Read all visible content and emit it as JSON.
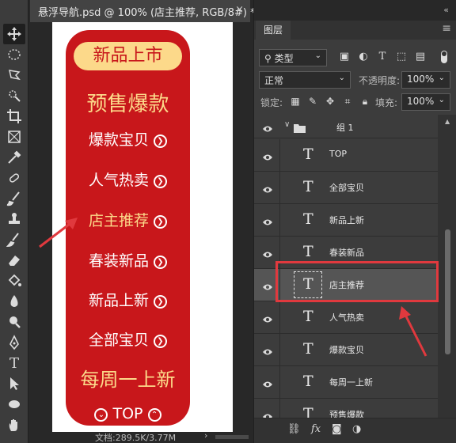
{
  "document": {
    "tab_title": "悬浮导航.psd @ 100% (店主推荐, RGB/8#) *",
    "close_glyph": "×"
  },
  "toolbar": {
    "tools": [
      "move-tool",
      "marquee-tool",
      "lasso-tool",
      "quick-select-tool",
      "crop-tool",
      "frame-tool",
      "eyedropper-tool",
      "healing-brush-tool",
      "brush-tool",
      "stamp-tool",
      "history-brush-tool",
      "eraser-tool",
      "paint-bucket-tool",
      "blur-tool",
      "dodge-tool",
      "pen-tool",
      "type-tool",
      "path-select-tool",
      "shape-tool",
      "hand-tool"
    ]
  },
  "artboard": {
    "top_pill": "新品上市",
    "presale": "预售爆款",
    "items": [
      {
        "label": "爆款宝贝",
        "highlight": false
      },
      {
        "label": "人气热卖",
        "highlight": false
      },
      {
        "label": "店主推荐",
        "highlight": true
      },
      {
        "label": "春装新品",
        "highlight": false
      },
      {
        "label": "新品上新",
        "highlight": false
      },
      {
        "label": "全部宝贝",
        "highlight": false
      }
    ],
    "weekly": "每周一上新",
    "top_label": "TOP",
    "colors": {
      "panel": "#c8171b",
      "gold": "#fcd98a"
    }
  },
  "status": {
    "text": "文档:289.5K/3.77M",
    "arrow": "›"
  },
  "panel": {
    "collapse": "«",
    "tab_label": "图层",
    "menu": "≡",
    "filter_label": "类型",
    "blend_mode": "正常",
    "opacity_label": "不透明度:",
    "opacity_value": "100%",
    "lock_label": "锁定:",
    "fill_label": "填充:",
    "fill_value": "100%",
    "group_name": "组 1",
    "layers": [
      {
        "name": "TOP",
        "selected": false
      },
      {
        "name": "全部宝贝",
        "selected": false
      },
      {
        "name": "新品上新",
        "selected": false
      },
      {
        "name": "春装新品",
        "selected": false
      },
      {
        "name": "店主推荐",
        "selected": true
      },
      {
        "name": "人气热卖",
        "selected": false
      },
      {
        "name": "爆款宝贝",
        "selected": false
      },
      {
        "name": "每周一上新",
        "selected": false
      },
      {
        "name": "预售爆款",
        "selected": false
      }
    ],
    "footer_buttons": [
      "link-icon",
      "fx",
      "mask-icon",
      "adjustment-icon"
    ],
    "fx_label": "fx"
  }
}
